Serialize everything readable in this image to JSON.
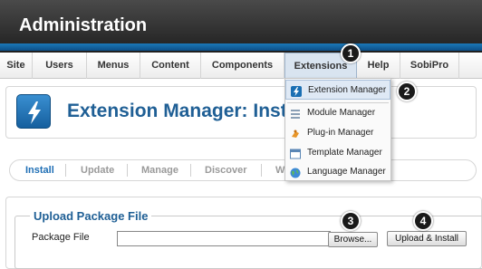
{
  "header": {
    "title": "Administration"
  },
  "menu": {
    "items": [
      {
        "label": "Site"
      },
      {
        "label": "Users"
      },
      {
        "label": "Menus"
      },
      {
        "label": "Content"
      },
      {
        "label": "Components"
      },
      {
        "label": "Extensions"
      },
      {
        "label": "Help"
      },
      {
        "label": "SobiPro"
      }
    ]
  },
  "dropdown": {
    "items": [
      {
        "label": "Extension Manager",
        "icon": "extension-manager-icon"
      },
      {
        "label": "Module Manager",
        "icon": "module-manager-icon"
      },
      {
        "label": "Plug-in Manager",
        "icon": "plugin-manager-icon"
      },
      {
        "label": "Template Manager",
        "icon": "template-manager-icon"
      },
      {
        "label": "Language Manager",
        "icon": "language-manager-icon"
      }
    ]
  },
  "page": {
    "title": "Extension Manager: Insta"
  },
  "subtabs": [
    {
      "label": "Install"
    },
    {
      "label": "Update"
    },
    {
      "label": "Manage"
    },
    {
      "label": "Discover"
    },
    {
      "label": "W"
    }
  ],
  "upload": {
    "legend": "Upload Package File",
    "field_label": "Package File",
    "browse_label": "Browse...",
    "install_label": "Upload & Install"
  },
  "callouts": [
    "1",
    "2",
    "3",
    "4"
  ],
  "colors": {
    "header_dark": "#2b2b2b",
    "header_blue": "#1466a6",
    "title_blue": "#1f5f95",
    "active_tab": "#1f6fb5"
  }
}
